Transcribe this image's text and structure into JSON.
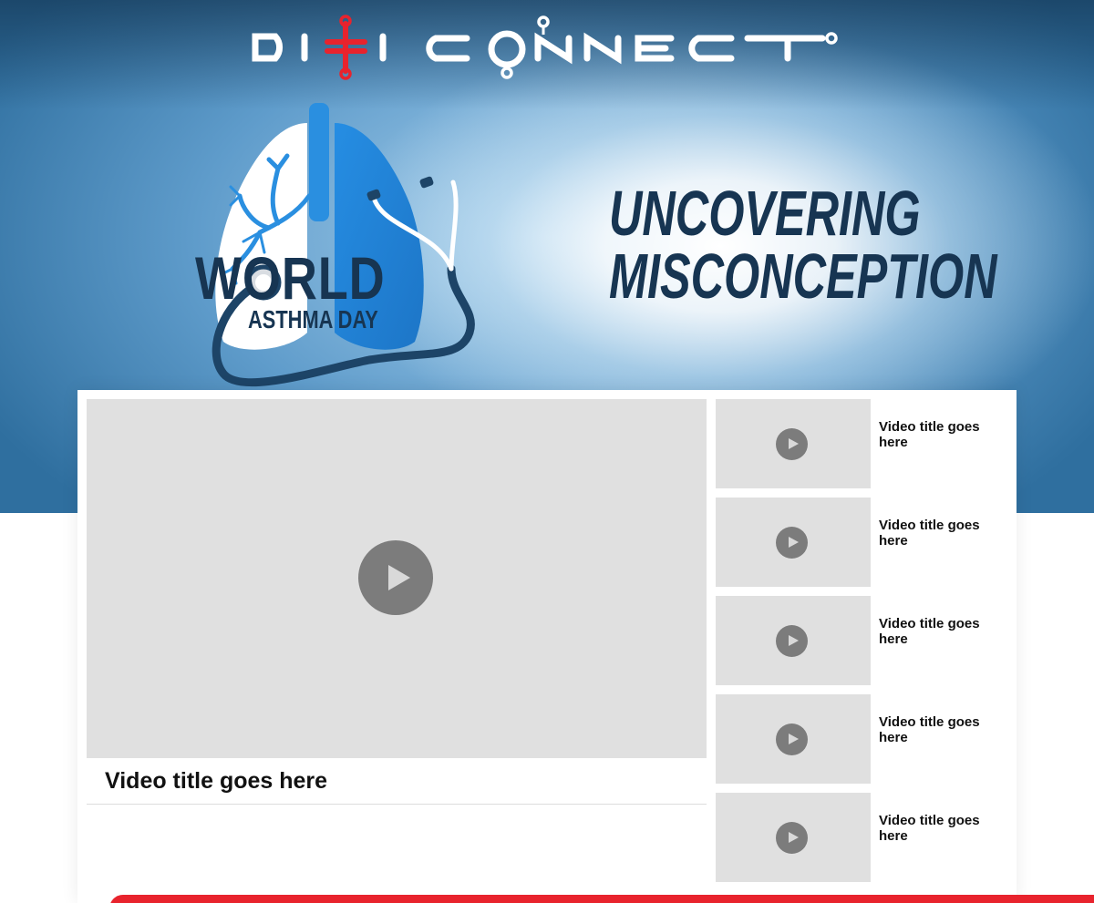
{
  "brand": {
    "logo_text": "DIGI CONNECT",
    "colors": {
      "logo_white": "#ffffff",
      "logo_accent": "#e8232d",
      "navy": "#173552",
      "hero_blue": "#5f9ccb"
    }
  },
  "hero": {
    "event_word": "WORLD",
    "event_sub": "ASTHMA DAY",
    "headline_line1": "UNCOVERING",
    "headline_line2": "MISCONCEPTION",
    "illustration": "lungs-stethoscope-icon"
  },
  "main_video": {
    "title": "Video title goes here",
    "play_icon": "play-icon"
  },
  "playlist": [
    {
      "title": "Video title goes here"
    },
    {
      "title": "Video title goes here"
    },
    {
      "title": "Video title goes here"
    },
    {
      "title": "Video title goes here"
    },
    {
      "title": "Video title goes here"
    }
  ],
  "footer": {
    "bar_color": "#e8232d"
  }
}
